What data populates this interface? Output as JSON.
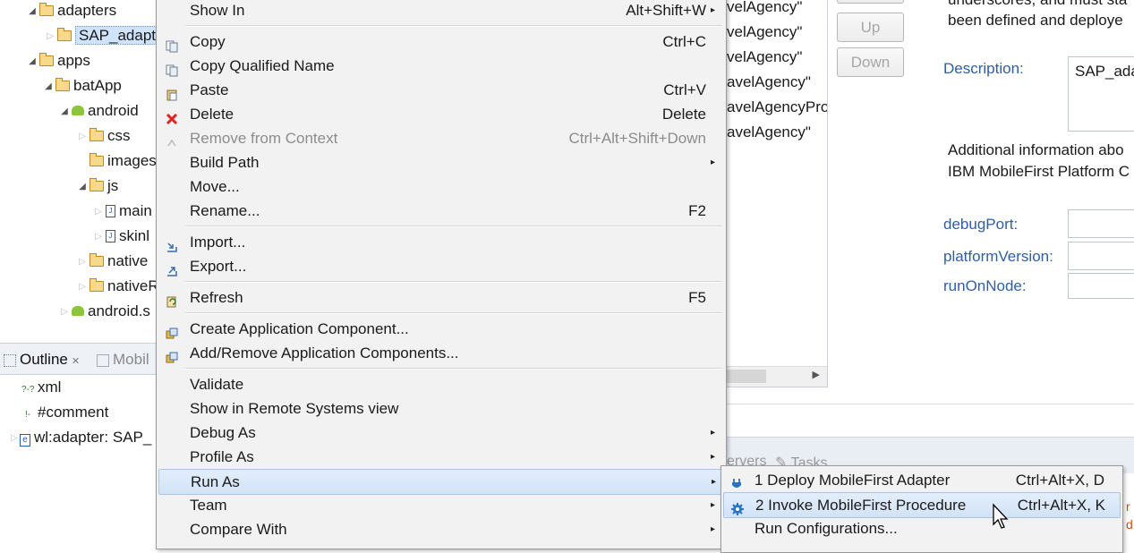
{
  "tree": [
    {
      "label": "adapters",
      "icon": "folder-open",
      "expander": "expanded"
    },
    {
      "label": "SAP_adapte",
      "icon": "folder",
      "expander": "collapsed",
      "selected": true
    },
    {
      "label": "apps",
      "icon": "folder-open",
      "expander": "expanded"
    },
    {
      "label": "batApp",
      "icon": "folder-open",
      "expander": "expanded"
    },
    {
      "label": "android",
      "icon": "android",
      "expander": "expanded"
    },
    {
      "label": "css",
      "icon": "folder",
      "expander": "collapsed"
    },
    {
      "label": "images",
      "icon": "folder",
      "expander": "none"
    },
    {
      "label": "js",
      "icon": "folder-open",
      "expander": "expanded"
    },
    {
      "label": "main",
      "icon": "js-file",
      "expander": "collapsed"
    },
    {
      "label": "skinl",
      "icon": "js-file",
      "expander": "collapsed"
    },
    {
      "label": "native",
      "icon": "folder",
      "expander": "collapsed"
    },
    {
      "label": "nativeR",
      "icon": "folder",
      "expander": "collapsed"
    },
    {
      "label": "android.s",
      "icon": "android",
      "expander": "collapsed"
    }
  ],
  "outline": {
    "tabs": [
      {
        "label": "Outline",
        "close": "✕"
      },
      {
        "label": "Mobil"
      }
    ],
    "nodes": [
      {
        "label": "xml",
        "icon": "?-?"
      },
      {
        "label": "#comment",
        "icon": "!-"
      },
      {
        "label": "wl:adapter: SAP_",
        "icon": "e"
      }
    ]
  },
  "list_items": [
    "velAgency\"",
    "velAgency\"",
    "velAgency\"",
    "avelAgency\"",
    "avelAgencyPro",
    "avelAgency\""
  ],
  "buttons": {
    "up": "Up",
    "down": "Down"
  },
  "right_panel": {
    "top_text_1": "underscores, and must sta",
    "top_text_2": "been defined and deploye",
    "description_label": "Description:",
    "description_value": "SAP_ada",
    "info_1": "Additional information abo",
    "info_2": "IBM MobileFirst Platform C",
    "fields": [
      "debugPort:",
      "platformVersion:",
      "runOnNode:"
    ]
  },
  "bottom_tabs": [
    "ervers",
    "Tasks"
  ],
  "context_menu": [
    {
      "label": "Show In",
      "accel": "Alt+Shift+W",
      "submenu": true
    },
    {
      "sep": true
    },
    {
      "label": "Copy",
      "accel": "Ctrl+C",
      "icon": "copy"
    },
    {
      "label": "Copy Qualified Name",
      "icon": "copy"
    },
    {
      "label": "Paste",
      "accel": "Ctrl+V",
      "icon": "paste"
    },
    {
      "label": "Delete",
      "accel": "Delete",
      "icon": "delete"
    },
    {
      "label": "Remove from Context",
      "accel": "Ctrl+Alt+Shift+Down",
      "disabled": true,
      "icon": "remove"
    },
    {
      "label": "Build Path",
      "submenu": true
    },
    {
      "label": "Move..."
    },
    {
      "label": "Rename...",
      "accel": "F2"
    },
    {
      "sep": true
    },
    {
      "label": "Import...",
      "icon": "import"
    },
    {
      "label": "Export...",
      "icon": "export"
    },
    {
      "sep": true
    },
    {
      "label": "Refresh",
      "accel": "F5",
      "icon": "refresh"
    },
    {
      "sep": true
    },
    {
      "label": "Create Application Component...",
      "icon": "component"
    },
    {
      "label": "Add/Remove Application Components...",
      "icon": "component"
    },
    {
      "sep": true
    },
    {
      "label": "Validate"
    },
    {
      "label": "Show in Remote Systems view"
    },
    {
      "label": "Debug As",
      "submenu": true
    },
    {
      "label": "Profile As",
      "submenu": true
    },
    {
      "label": "Run As",
      "submenu": true,
      "highlighted": true
    },
    {
      "label": "Team",
      "submenu": true
    },
    {
      "label": "Compare With",
      "submenu": true
    }
  ],
  "run_as_submenu": [
    {
      "label": "1 Deploy MobileFirst Adapter",
      "accel": "Ctrl+Alt+X, D",
      "icon": "deploy"
    },
    {
      "label": "2 Invoke MobileFirst Procedure",
      "accel": "Ctrl+Alt+X, K",
      "icon": "gear",
      "highlighted": true
    },
    {
      "label": "Run Configurations..."
    }
  ],
  "colors": {
    "menu_bg": "#f2f2f2",
    "highlight": "#d2e3f7",
    "link_label": "#2e5ea8",
    "selection": "#cfe3fb"
  }
}
